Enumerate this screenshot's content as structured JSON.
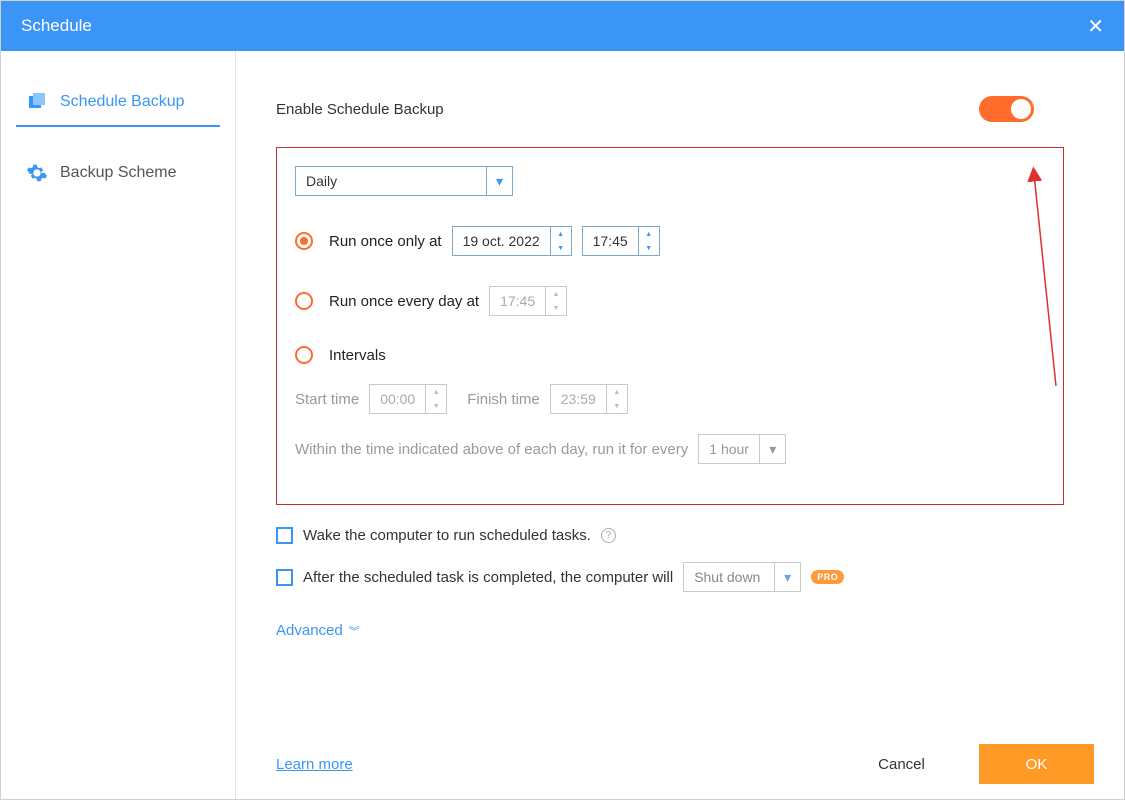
{
  "titlebar": {
    "title": "Schedule"
  },
  "sidebar": {
    "items": [
      {
        "label": "Schedule Backup"
      },
      {
        "label": "Backup Scheme"
      }
    ]
  },
  "enable": {
    "label": "Enable Schedule Backup",
    "on": true
  },
  "frequency": {
    "selected": "Daily"
  },
  "options": {
    "runOnceOnly": {
      "label": "Run once only at",
      "date": "19 oct. 2022",
      "time": "17:45"
    },
    "runOnceDaily": {
      "label": "Run once every day at",
      "time": "17:45"
    },
    "intervals": {
      "label": "Intervals",
      "startLabel": "Start time",
      "startValue": "00:00",
      "finishLabel": "Finish time",
      "finishValue": "23:59",
      "withinText": "Within the time indicated above of each day, run it for every",
      "everyValue": "1 hour"
    }
  },
  "checkboxes": {
    "wake": "Wake the computer to run scheduled tasks.",
    "afterTask": "After the scheduled task is completed, the computer will"
  },
  "postAction": {
    "selected": "Shut down"
  },
  "badges": {
    "pro": "PRO"
  },
  "links": {
    "advanced": "Advanced",
    "learn": "Learn more"
  },
  "footer": {
    "cancel": "Cancel",
    "ok": "OK"
  }
}
